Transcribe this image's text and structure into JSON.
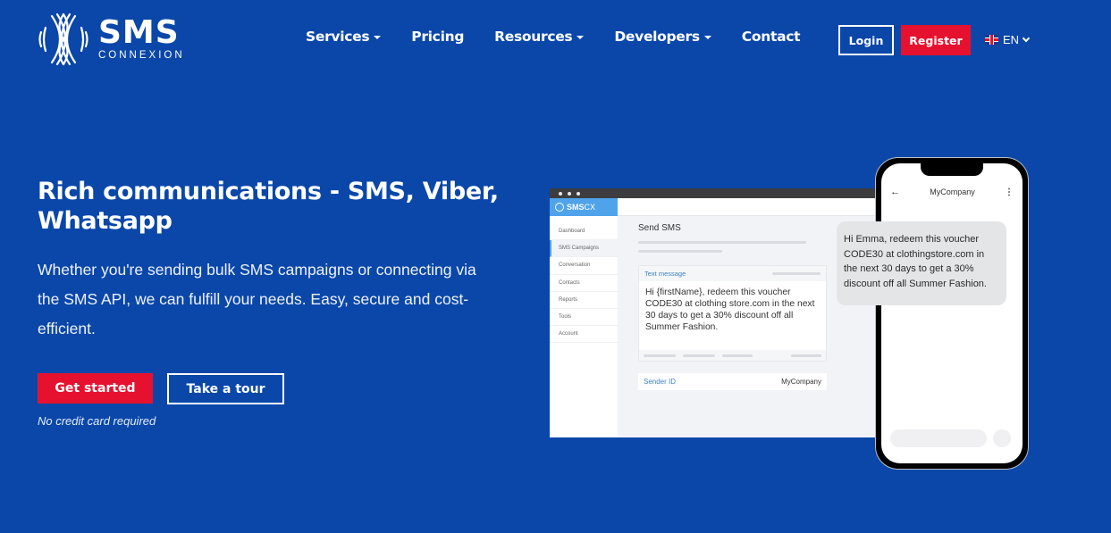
{
  "brand": {
    "name": "SMS",
    "tagline": "CONNEXION"
  },
  "nav": {
    "items": [
      {
        "label": "Services",
        "dropdown": true
      },
      {
        "label": "Pricing",
        "dropdown": false
      },
      {
        "label": "Resources",
        "dropdown": true
      },
      {
        "label": "Developers",
        "dropdown": true
      },
      {
        "label": "Contact",
        "dropdown": false
      }
    ],
    "login_label": "Login",
    "register_label": "Register",
    "language": "EN",
    "language_icon": "uk-flag-icon"
  },
  "hero": {
    "title": "Rich communications - SMS, Viber, Whatsapp",
    "description": "Whether you're sending bulk SMS campaigns or connecting via the SMS API, we can fulfill your needs. Easy, secure and cost-efficient.",
    "primary_cta": "Get started",
    "secondary_cta": "Take a tour",
    "note": "No credit card required"
  },
  "mockup": {
    "app_logo": "SMS",
    "app_logo_suffix": "CX",
    "sidebar": [
      "Dashboard",
      "SMS Campaigns",
      "Conversation",
      "Contacts",
      "Reports",
      "Tools",
      "Account"
    ],
    "active_sidebar": "SMS Campaigns",
    "page_title": "Send SMS",
    "text_message_label": "Text message",
    "text_message_body": "Hi {firstName}, redeem this voucher CODE30 at clothing store.com in the next 30 days to get a 30% discount off all Summer Fashion.",
    "sender_id_label": "Sender ID",
    "sender_id_value": "MyCompany"
  },
  "phone": {
    "contact_name": "MyCompany",
    "message": "Hi Emma, redeem this voucher CODE30 at clothingstore.com in the next 30 days to get a 30% discount off all Summer Fashion."
  },
  "colors": {
    "background": "#0a47a9",
    "accent_red": "#e6112f",
    "mock_blue": "#4fa3ea"
  }
}
